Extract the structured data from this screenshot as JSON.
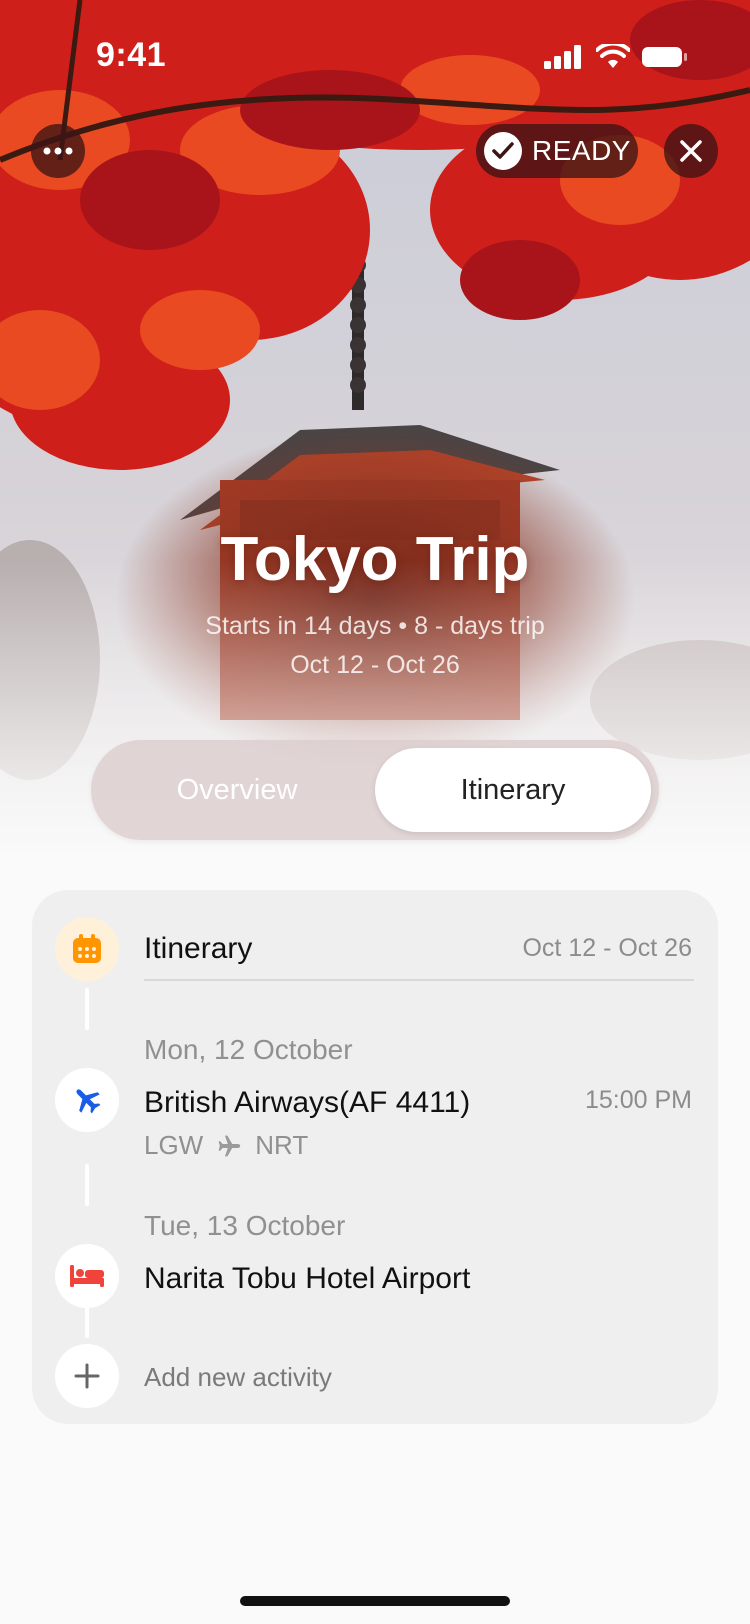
{
  "status_bar": {
    "time": "9:41"
  },
  "hero": {
    "ready_label": "READY",
    "title": "Tokyo Trip",
    "subtitle": "Starts in 14 days • 8 - days trip",
    "dates": "Oct 12 - Oct 26"
  },
  "tabs": [
    {
      "label": "Overview",
      "selected": false
    },
    {
      "label": "Itinerary",
      "selected": true
    }
  ],
  "itinerary": {
    "header_label": "Itinerary",
    "header_dates": "Oct 12 - Oct 26",
    "days": [
      {
        "day": "Mon, 12 October",
        "title": "British Airways(AF 4411)",
        "time": "15:00 PM",
        "route_from": "LGW",
        "route_to": "NRT",
        "icon": "airplane-icon"
      },
      {
        "day": "Tue, 13 October",
        "title": "Narita Tobu Hotel Airport",
        "icon": "bed-icon"
      }
    ],
    "add_label": "Add new activity"
  },
  "colors": {
    "calendar_orange": "#ff9500",
    "plane_blue": "#1a5ce6",
    "bed_red": "#f0443a",
    "maple_red": "#d6231c"
  }
}
